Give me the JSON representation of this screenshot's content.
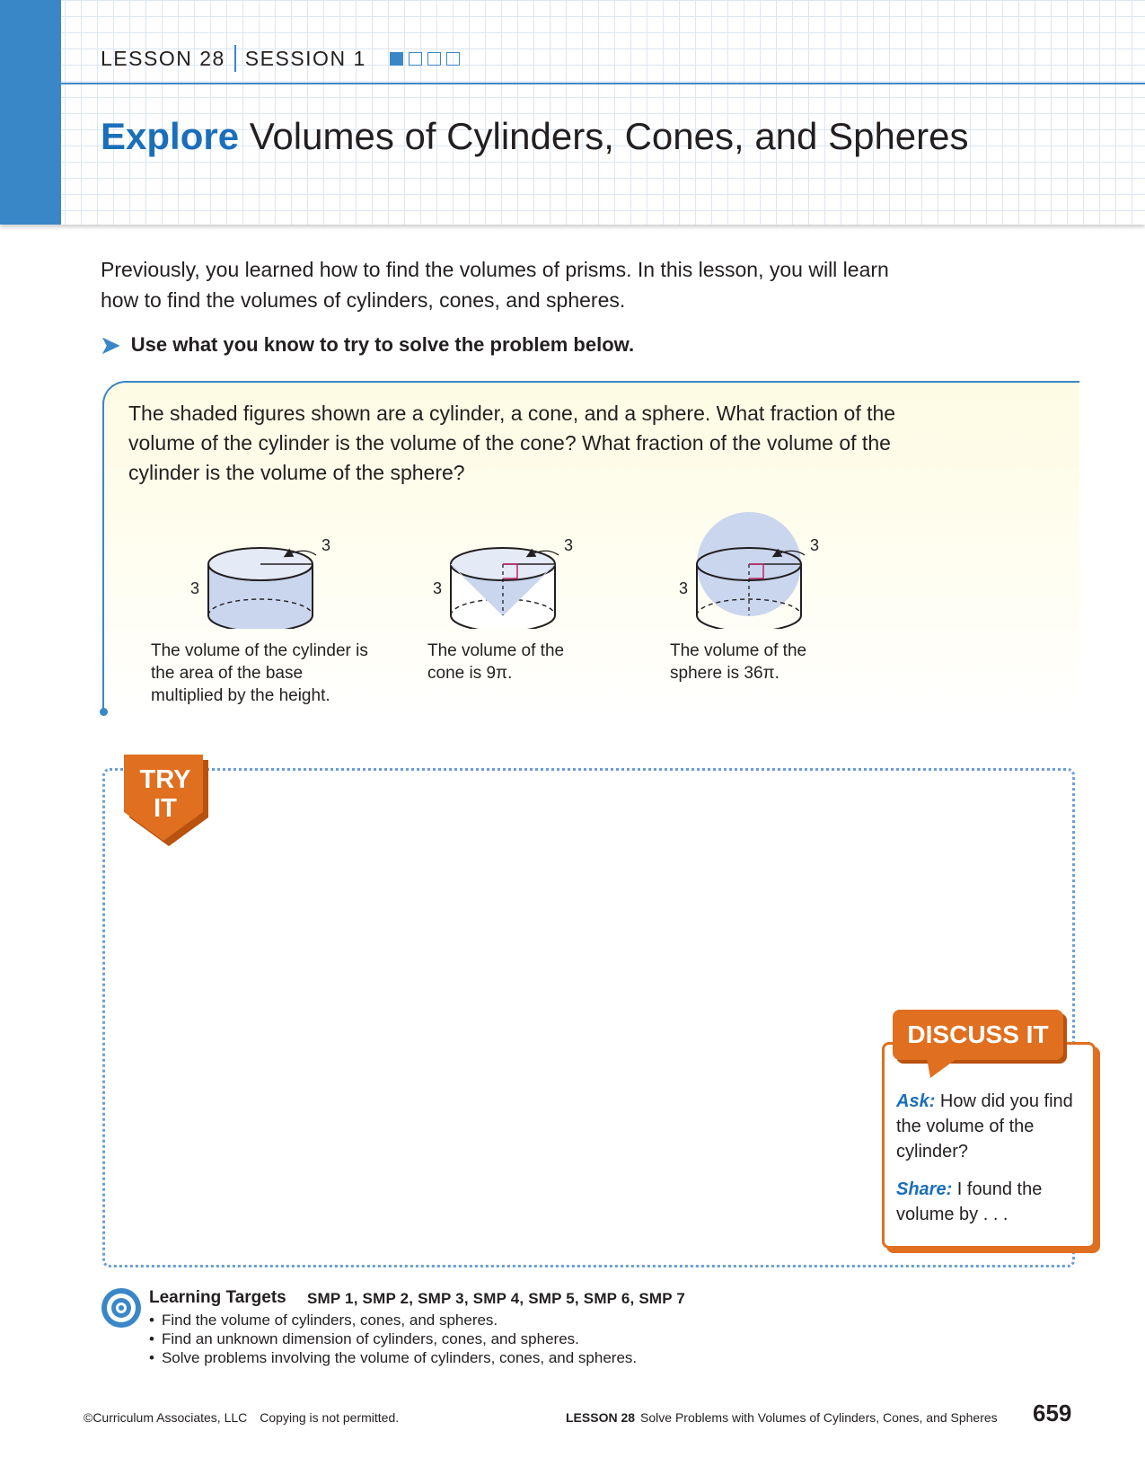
{
  "header": {
    "lesson": "LESSON 28",
    "session": "SESSION 1",
    "session_progress": {
      "current": 1,
      "total": 4
    },
    "title_keyword": "Explore",
    "title_rest": " Volumes of Cylinders, Cones, and Spheres"
  },
  "intro": {
    "paragraph": "Previously, you learned how to find the volumes of prisms. In this lesson, you will learn how to find the volumes of cylinders, cones, and spheres.",
    "instruction": "Use what you know to try to solve the problem below."
  },
  "problem": {
    "text": "The shaded figures shown are a cylinder, a cone, and a sphere. What fraction of the volume of the cylinder is the volume of the cone? What fraction of the volume of the cylinder is the volume of the sphere?",
    "figures": [
      {
        "radius_label": "3",
        "height_label": "3",
        "caption": "The volume of the cylinder is the area of the base multiplied by the height."
      },
      {
        "radius_label": "3",
        "height_label": "3",
        "caption": "The volume of the cone is 9π."
      },
      {
        "radius_label": "3",
        "height_label": "3",
        "caption": "The volume of the sphere is 36π."
      }
    ]
  },
  "try_it": {
    "line1": "TRY",
    "line2": "IT"
  },
  "discuss": {
    "title": "DISCUSS IT",
    "ask_label": "Ask:",
    "ask_text": " How did you find the volume of the cylinder?",
    "share_label": "Share:",
    "share_text": " I found the volume by . . ."
  },
  "learning_targets": {
    "title": "Learning Targets",
    "smp": "SMP 1, SMP 2, SMP 3, SMP 4, SMP 5, SMP 6, SMP 7",
    "items": [
      "Find the volume of cylinders, cones, and spheres.",
      "Find an unknown dimension of cylinders, cones, and spheres.",
      "Solve problems involving the volume of cylinders, cones, and spheres."
    ]
  },
  "footer": {
    "copyright": "©Curriculum Associates, LLC",
    "copy_notice": "Copying is not permitted.",
    "lesson_label": "LESSON 28",
    "lesson_title": "Solve Problems with Volumes of Cylinders, Cones, and Spheres",
    "page_number": "659"
  },
  "colors": {
    "accent_blue": "#3a87c8",
    "title_blue": "#1a6fba",
    "orange": "#e06f1f",
    "figure_fill": "#c9d6ee"
  }
}
